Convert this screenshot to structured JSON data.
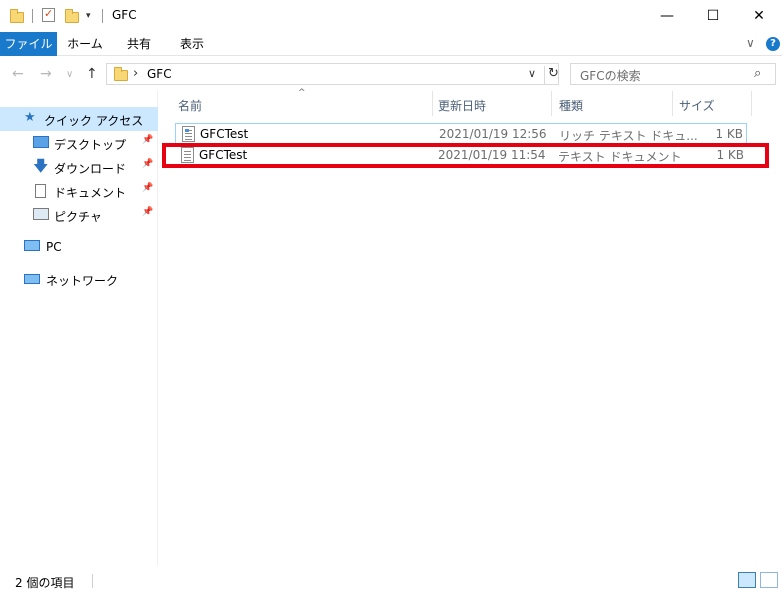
{
  "window": {
    "title": "GFC",
    "minimize_glyph": "—",
    "maximize_glyph": "☐",
    "close_glyph": "✕"
  },
  "ribbon": {
    "tabs": [
      {
        "label": "ファイル",
        "active": true
      },
      {
        "label": "ホーム"
      },
      {
        "label": "共有"
      },
      {
        "label": "表示"
      }
    ],
    "expand_glyph": "∨",
    "help_glyph": "?"
  },
  "nav": {
    "back_glyph": "←",
    "forward_glyph": "→",
    "recent_glyph": "∨",
    "up_glyph": "↑",
    "address": {
      "separator": "›",
      "path": "GFC",
      "dropdown_glyph": "∨",
      "refresh_glyph": "↻"
    },
    "search": {
      "placeholder": "GFCの検索",
      "icon_glyph": "⌕"
    }
  },
  "sidebar": {
    "pin_glyph": "📌",
    "items": [
      {
        "label": "クイック アクセス",
        "icon": "star-icon",
        "selected": true
      },
      {
        "label": "デスクトップ",
        "icon": "desktop-icon",
        "pinned": true
      },
      {
        "label": "ダウンロード",
        "icon": "download-icon",
        "pinned": true
      },
      {
        "label": "ドキュメント",
        "icon": "documents-icon",
        "pinned": true
      },
      {
        "label": "ピクチャ",
        "icon": "pictures-icon",
        "pinned": true
      },
      {
        "label": "PC",
        "icon": "pc-icon"
      },
      {
        "label": "ネットワーク",
        "icon": "network-icon"
      }
    ]
  },
  "columns": {
    "sort_glyph": "^",
    "name": "名前",
    "date": "更新日時",
    "type": "種類",
    "size": "サイズ"
  },
  "files": [
    {
      "name": "GFCTest",
      "date": "2021/01/19 12:56",
      "type": "リッチ テキスト ドキュ...",
      "size": "1 KB",
      "icon": "rtf-file-icon"
    },
    {
      "name": "GFCTest",
      "date": "2021/01/19 11:54",
      "type": "テキスト ドキュメント",
      "size": "1 KB",
      "icon": "txt-file-icon"
    }
  ],
  "status": {
    "item_count": "2 個の項目"
  },
  "colors": {
    "accent": "#1979ca",
    "selection": "#cce8ff",
    "highlight_box": "#e60012"
  }
}
